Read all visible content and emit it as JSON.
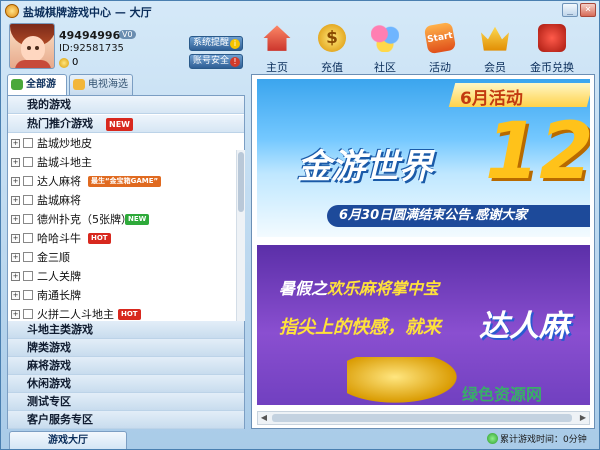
{
  "window": {
    "title": "盐城棋牌游戏中心 — 大厅",
    "min_label": "_",
    "close_label": "×"
  },
  "profile": {
    "coins": "494949964",
    "vip_badge": "V0",
    "user_id": "ID:92581735",
    "gold": "0"
  },
  "side_buttons": {
    "system_tip": "系统提醒",
    "system_tip_badge": "i",
    "account_security": "账号安全",
    "account_security_badge": "!"
  },
  "toolbar": {
    "home": "主页",
    "recharge": "充值",
    "recharge_icon_text": "$",
    "community": "社区",
    "activity": "活动",
    "activity_icon_text": "Start",
    "member": "会员",
    "exchange": "金币兑换"
  },
  "tabs": {
    "all_games": "全部游戏",
    "tv_selection": "电视海选"
  },
  "games": {
    "my_games": "我的游戏",
    "hot_header": "热门推介游戏",
    "hot_tag": "NEW",
    "rows": [
      {
        "name": "盐城炒地皮",
        "tag": "",
        "tag_type": ""
      },
      {
        "name": "盐城斗地主",
        "tag": "",
        "tag_type": ""
      },
      {
        "name": "达人麻将",
        "tag": "最生“金宝箱GAME”",
        "tag_type": "promo"
      },
      {
        "name": "盐城麻将",
        "tag": "",
        "tag_type": ""
      },
      {
        "name": "德州扑克（5张牌）",
        "tag": "NEW",
        "tag_type": "new"
      },
      {
        "name": "哈哈斗牛",
        "tag": "HOT",
        "tag_type": "hot"
      },
      {
        "name": "金三顺",
        "tag": "",
        "tag_type": ""
      },
      {
        "name": "二人关牌",
        "tag": "",
        "tag_type": ""
      },
      {
        "name": "南通长牌",
        "tag": "",
        "tag_type": ""
      },
      {
        "name": "火拼二人斗地主",
        "tag": "HOT",
        "tag_type": "hot"
      }
    ],
    "expand_symbol": "+",
    "categories": [
      "斗地主类游戏",
      "牌类游戏",
      "麻将游戏",
      "休闲游戏",
      "测试专区",
      "客户服务专区"
    ]
  },
  "banner": {
    "month": "6月活动",
    "title": "金游世界",
    "number": "12",
    "subline": "6月30日圆满结束公告.感谢大家",
    "promo_line1_prefix": "暑假之",
    "promo_line1_highlight": "欢乐麻将掌中宝",
    "promo_line2": "指尖上的快感，就来",
    "promo_brand": "达人麻",
    "watermark": "绿色资源网"
  },
  "status": {
    "tab": "游戏大厅",
    "text": "累计游戏时间：0分钟"
  },
  "colors": {
    "accent": "#2f5f95",
    "hot": "#d8281e",
    "new": "#2eaa3a"
  }
}
